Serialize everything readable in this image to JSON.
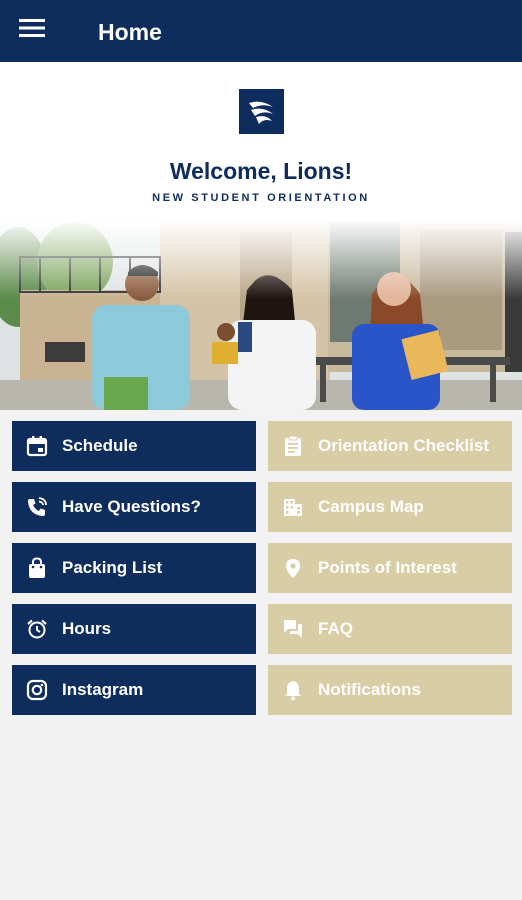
{
  "appbar": {
    "title": "Home",
    "menu_icon": "hamburger-menu-icon"
  },
  "hero": {
    "logo_icon": "lion-crest-icon",
    "welcome_text": "Welcome, Lions!",
    "subtitle": "NEW STUDENT ORIENTATION"
  },
  "menu": {
    "left": [
      {
        "label": "Schedule",
        "icon": "calendar-icon"
      },
      {
        "label": "Have Questions?",
        "icon": "phone-call-icon"
      },
      {
        "label": "Packing List",
        "icon": "shopping-bag-icon"
      },
      {
        "label": "Hours",
        "icon": "alarm-clock-icon"
      },
      {
        "label": "Instagram",
        "icon": "instagram-icon"
      }
    ],
    "right": [
      {
        "label": "Orientation Checklist",
        "icon": "clipboard-icon"
      },
      {
        "label": "Campus Map",
        "icon": "building-icon"
      },
      {
        "label": "Points of Interest",
        "icon": "location-pin-icon"
      },
      {
        "label": "FAQ",
        "icon": "chat-bubbles-icon"
      },
      {
        "label": "Notifications",
        "icon": "bell-icon"
      }
    ]
  },
  "colors": {
    "primary_navy": "#0f2d5c",
    "gold": "#d8cda4",
    "background": "#f2f2f2"
  }
}
